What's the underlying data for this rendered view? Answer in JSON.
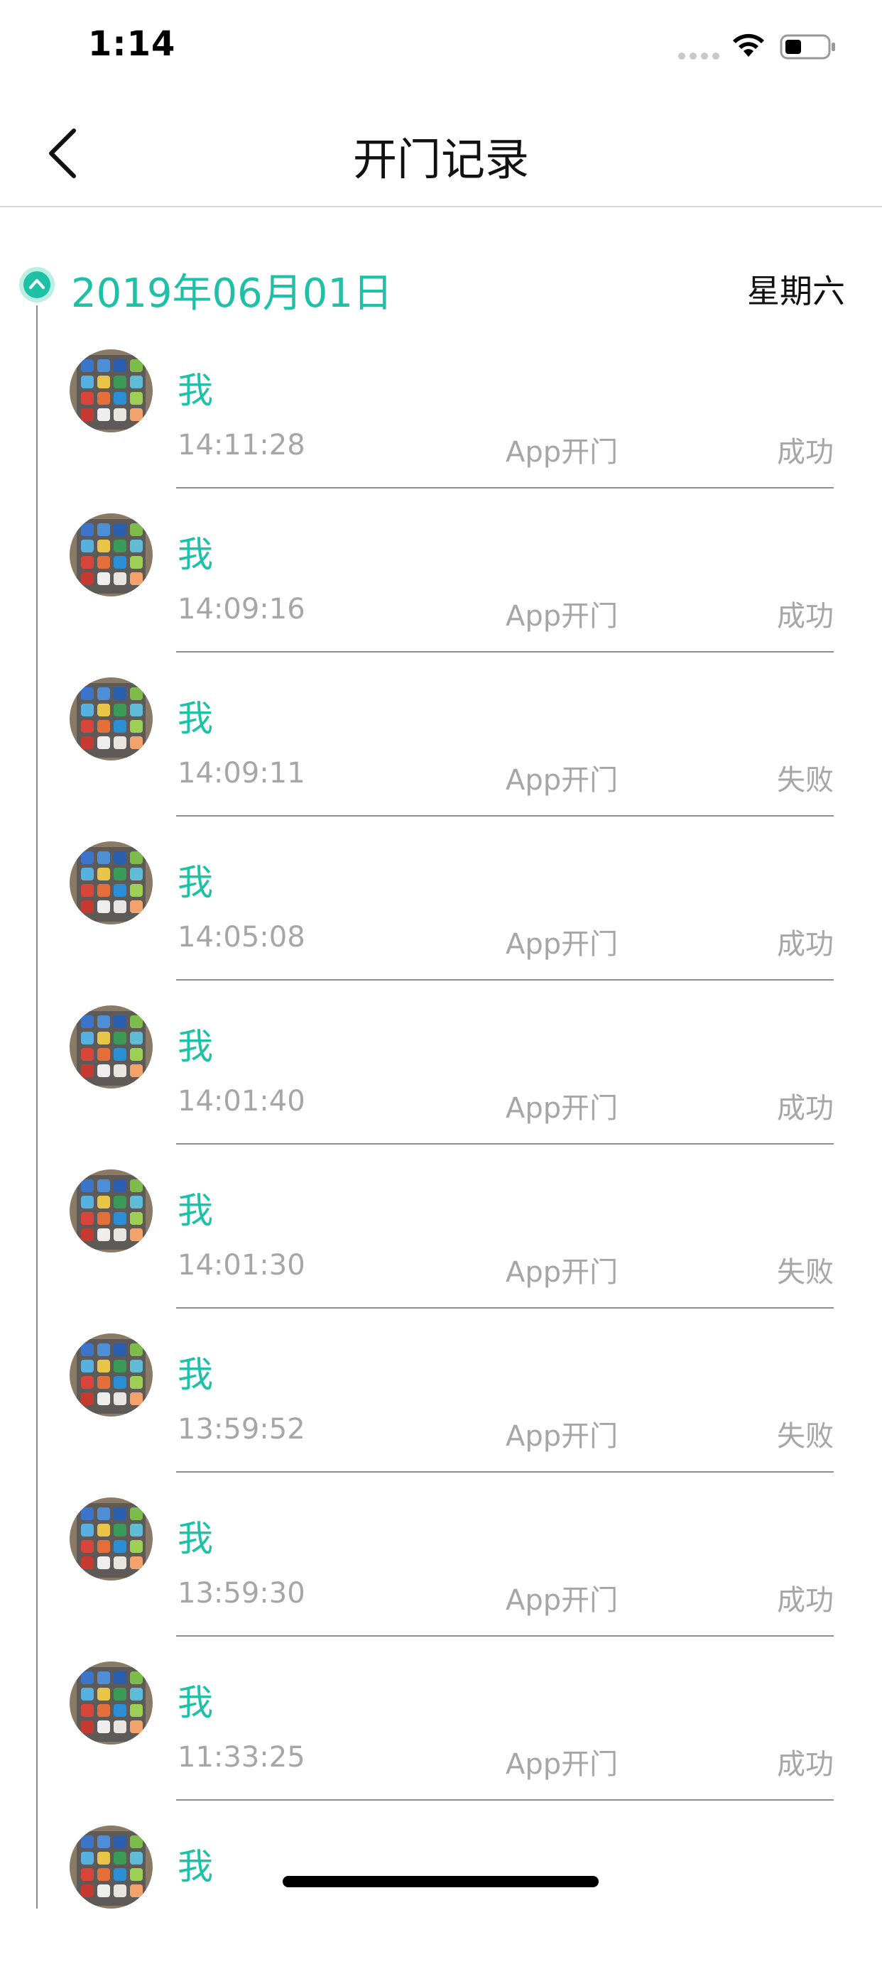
{
  "status_bar": {
    "time": "1:14"
  },
  "nav": {
    "title": "开门记录"
  },
  "date_group": {
    "date": "2019年06月01日",
    "weekday": "星期六"
  },
  "records": [
    {
      "name": "我",
      "time": "14:11:28",
      "method": "App开门",
      "result": "成功"
    },
    {
      "name": "我",
      "time": "14:09:16",
      "method": "App开门",
      "result": "成功"
    },
    {
      "name": "我",
      "time": "14:09:11",
      "method": "App开门",
      "result": "失败"
    },
    {
      "name": "我",
      "time": "14:05:08",
      "method": "App开门",
      "result": "成功"
    },
    {
      "name": "我",
      "time": "14:01:40",
      "method": "App开门",
      "result": "成功"
    },
    {
      "name": "我",
      "time": "14:01:30",
      "method": "App开门",
      "result": "失败"
    },
    {
      "name": "我",
      "time": "13:59:52",
      "method": "App开门",
      "result": "失败"
    },
    {
      "name": "我",
      "time": "13:59:30",
      "method": "App开门",
      "result": "成功"
    },
    {
      "name": "我",
      "time": "11:33:25",
      "method": "App开门",
      "result": "成功"
    },
    {
      "name": "我",
      "time": "",
      "method": "",
      "result": ""
    }
  ],
  "colors": {
    "accent": "#1fc1a6",
    "secondary_text": "#a6a6a6"
  },
  "icons": {
    "back": "chevron-left-icon",
    "collapse": "chevron-up-circle-icon",
    "wifi": "wifi-icon",
    "battery": "battery-icon"
  }
}
